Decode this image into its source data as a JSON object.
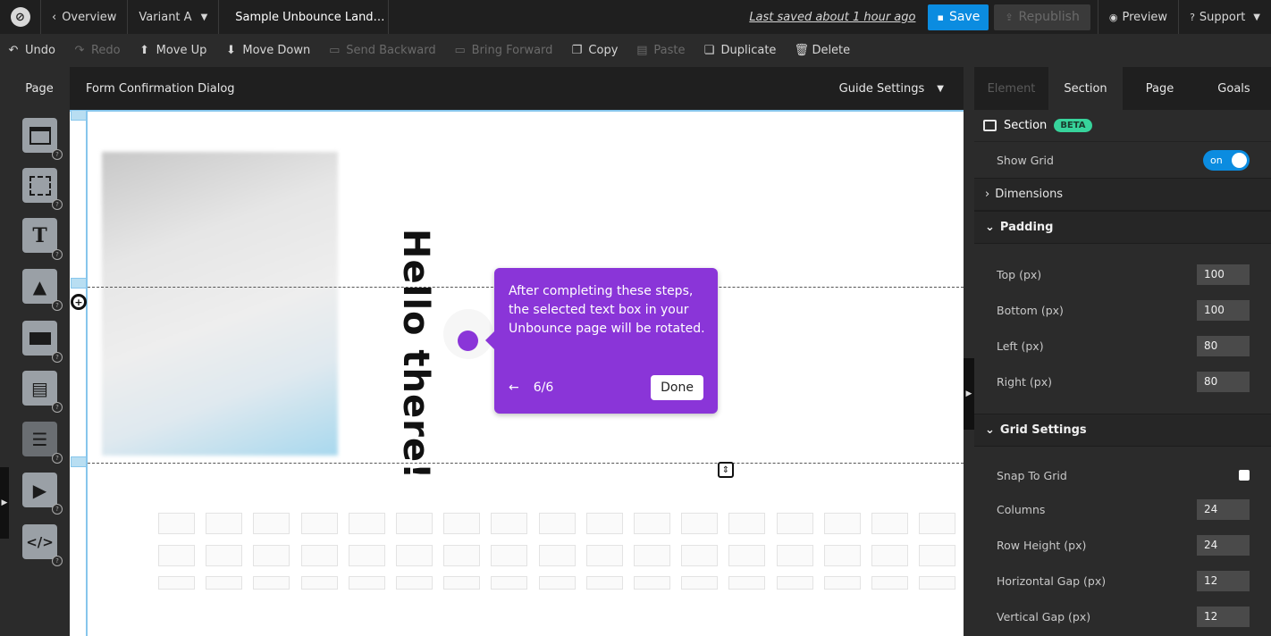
{
  "topbar": {
    "logo": "logo-icon",
    "overview": "Overview",
    "variant": "Variant A",
    "title": "Sample Unbounce Land…",
    "last_saved": "Last saved  about 1 hour ago",
    "save": "Save",
    "republish": "Republish",
    "preview": "Preview",
    "support": "Support"
  },
  "toolbar": {
    "undo": "Undo",
    "redo": "Redo",
    "move_up": "Move Up",
    "move_down": "Move Down",
    "send_backward": "Send Backward",
    "bring_forward": "Bring Forward",
    "copy": "Copy",
    "paste": "Paste",
    "duplicate": "Duplicate",
    "delete": "Delete"
  },
  "pagestrip": {
    "page_tab": "Page",
    "name": "Form Confirmation Dialog",
    "guide_settings": "Guide Settings"
  },
  "canvas": {
    "headline": "Hello there!"
  },
  "tooltip": {
    "text": "After completing these steps, the selected text box in your Unbounce page will be rotated.",
    "step": "6/6",
    "done": "Done",
    "accent": "#8a35d8"
  },
  "panel": {
    "tabs": [
      "Element",
      "Section",
      "Page",
      "Goals"
    ],
    "section_title": "Section",
    "beta": "BETA",
    "show_grid": "Show Grid",
    "toggle": "on",
    "dimensions": "Dimensions",
    "padding": "Padding",
    "top": {
      "label": "Top (px)",
      "value": "100"
    },
    "bottom": {
      "label": "Bottom (px)",
      "value": "100"
    },
    "left": {
      "label": "Left (px)",
      "value": "80"
    },
    "right": {
      "label": "Right (px)",
      "value": "80"
    },
    "grid_settings": "Grid Settings",
    "snap": "Snap To Grid",
    "columns": {
      "label": "Columns",
      "value": "24"
    },
    "row_height": {
      "label": "Row Height (px)",
      "value": "24"
    },
    "hgap": {
      "label": "Horizontal Gap (px)",
      "value": "12"
    },
    "vgap": {
      "label": "Vertical Gap (px)",
      "value": "12"
    }
  },
  "colors": {
    "accent": "#0b8ce0",
    "beta": "#37d39b"
  }
}
